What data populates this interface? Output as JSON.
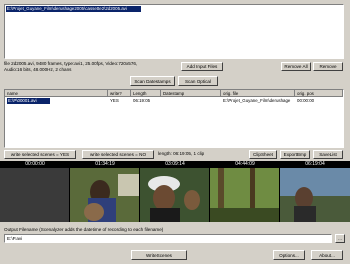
{
  "files": {
    "items": [
      "E:\\Projet_Guyane_Film\\derushage2005\\cassette2\\2d2005.avi"
    ]
  },
  "info": {
    "line1": "file 2d2005.avi, 9480 frames, type:avi1, 25.00fps, Video:720x576,",
    "line2": "Audio:16 bits, 48.000Hz, 2 chans"
  },
  "buttons": {
    "add_input_files": "Add Input Files",
    "remove_all": "Remove All",
    "remove": "Remove",
    "scan_datestamps": "Scan Datestamps",
    "scan_optical": "Scan Optical",
    "write_selected_yes": "write selected scenes = YES",
    "write_selected_no": "write selected scenes = NO",
    "clipsheet": "ClipSheet",
    "exportbmp": "ExportBmp",
    "savelist": "SaveList",
    "browse": "...",
    "writescenes": "WriteScenes",
    "options": "Options...",
    "about": "About..."
  },
  "scenes": {
    "columns": [
      "name",
      "write?",
      "Length",
      "Datestamp",
      "orig. file",
      "orig. pos"
    ],
    "rows": [
      {
        "name": "E:\\P\\00001.avi",
        "write": "YES",
        "length": "06:19:05",
        "datestamp": "",
        "orig_file": "E:\\Projet_Guyane_Film\\derushage",
        "orig_pos": "00:00:00"
      }
    ]
  },
  "length_summary": "length: 06:19:05, 1 clip",
  "timeline": {
    "timecodes": [
      "00:00:00",
      "01:34:19",
      "03:09:14",
      "04:44:09",
      "06:19:04"
    ]
  },
  "output": {
    "label": "Output Filename (Scenalyzer adds the datetime of recording to each filename)",
    "value": "E:\\P.avi"
  }
}
